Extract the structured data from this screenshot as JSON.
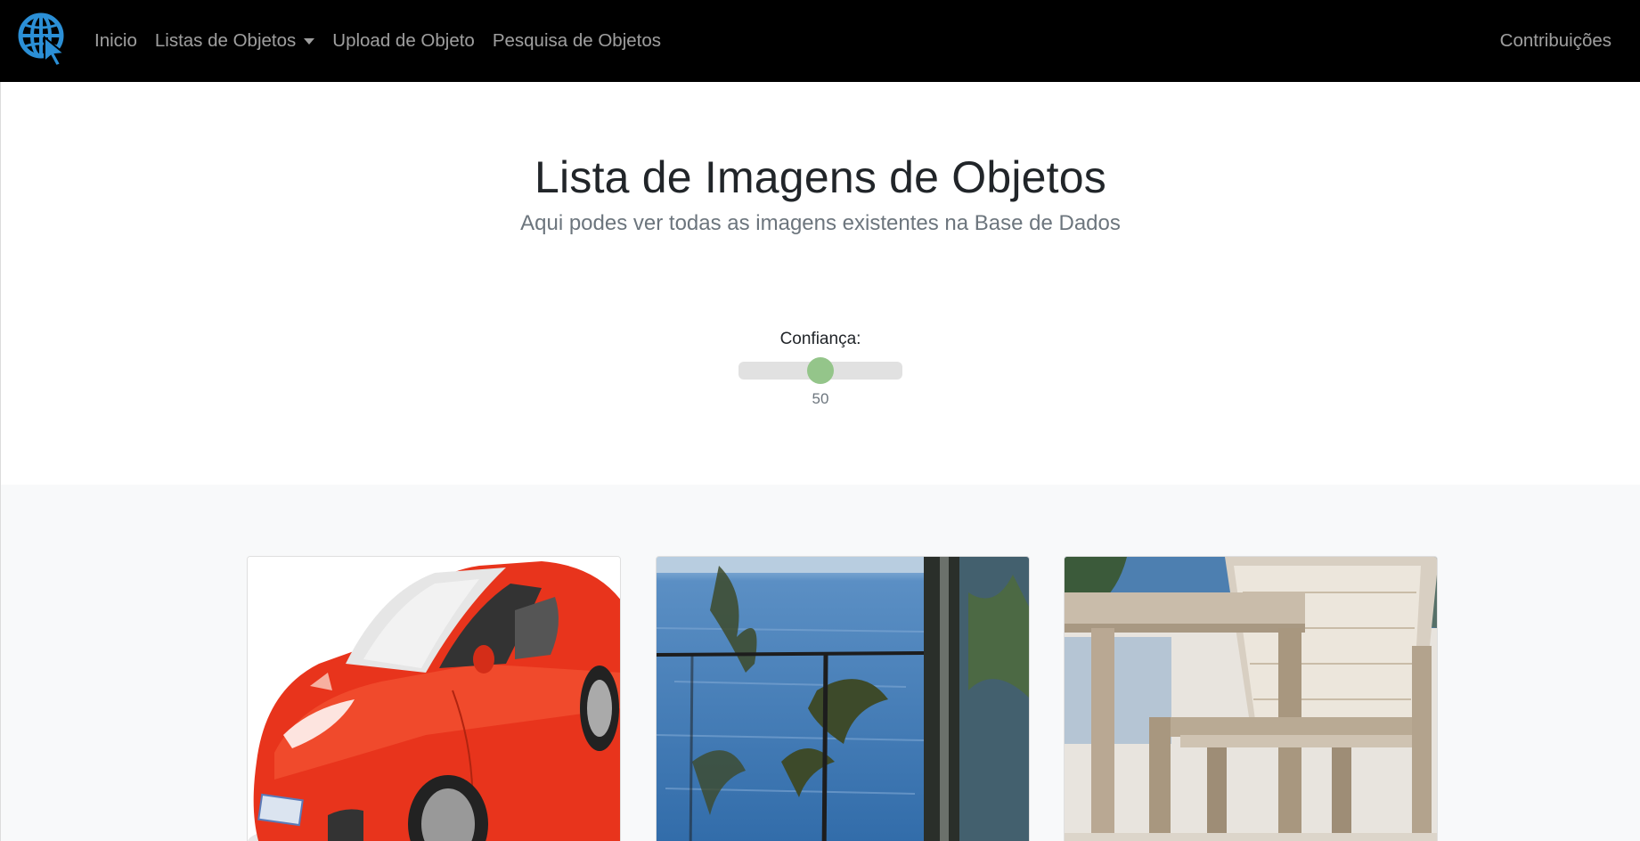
{
  "navbar": {
    "logo_icon": "globe-cursor-icon",
    "links": [
      {
        "label": "Inicio"
      },
      {
        "label": "Listas de Objetos",
        "dropdown": true
      },
      {
        "label": "Upload de Objeto"
      },
      {
        "label": "Pesquisa de Objetos"
      }
    ],
    "right_link": "Contribuições"
  },
  "header": {
    "title": "Lista de Imagens de Objetos",
    "subtitle": "Aqui podes ver todas as imagens existentes na Base de Dados"
  },
  "confidence": {
    "label": "Confiança:",
    "value": 50,
    "value_text": "50",
    "min": 0,
    "max": 100
  },
  "gallery": {
    "images": [
      {
        "subject": "red sports car"
      },
      {
        "subject": "sea view through window with trees"
      },
      {
        "subject": "wooden chairs on terrace"
      }
    ]
  },
  "colors": {
    "navbar_bg": "#000000",
    "logo_blue": "#2b8fd6",
    "slider_thumb": "#94c58a",
    "slider_track": "#e1e1e1",
    "gallery_bg": "#f8f9fa"
  }
}
